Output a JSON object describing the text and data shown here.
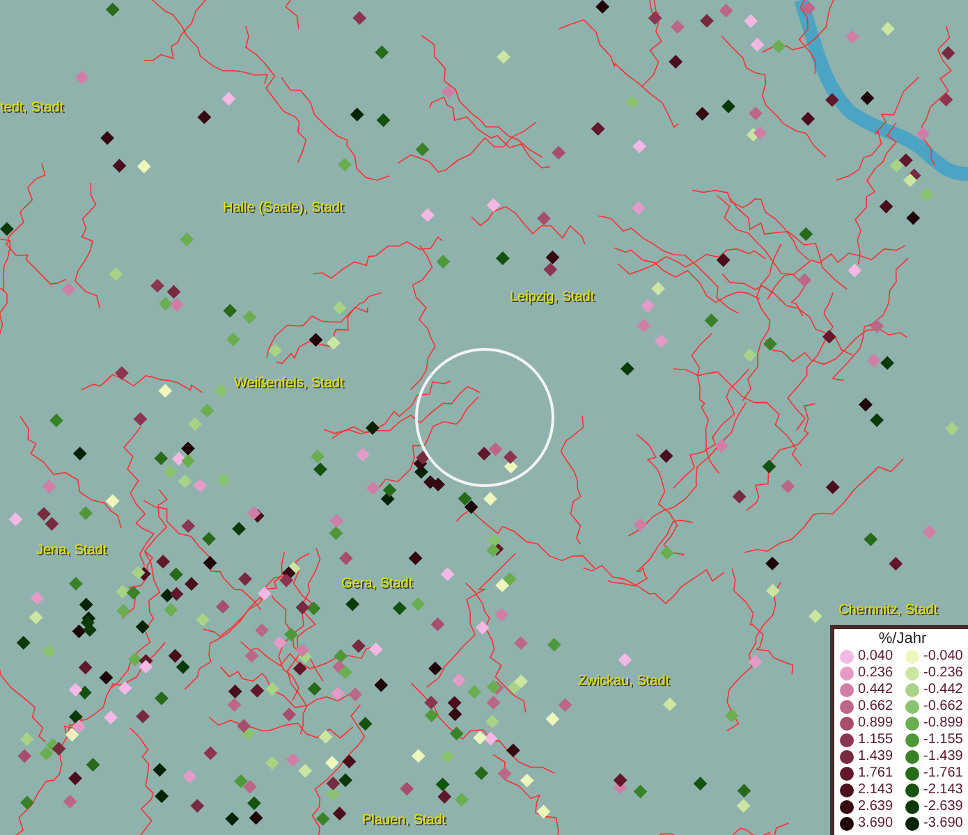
{
  "map": {
    "cities": [
      {
        "name": "tedt, Stadt"
      },
      {
        "name": "Halle (Saale), Stadt"
      },
      {
        "name": "Leipzig, Stadt"
      },
      {
        "name": "Weißenfels, Stadt"
      },
      {
        "name": "Jena, Stadt"
      },
      {
        "name": "Gera, Stadt"
      },
      {
        "name": "Chemnitz, Stadt"
      },
      {
        "name": "Zwickau, Stadt"
      },
      {
        "name": "Plauen, Stadt"
      }
    ]
  },
  "legend": {
    "title": "%/Jahr",
    "rows": [
      {
        "positive": {
          "label": "0.040",
          "color": "#f4b8e4"
        },
        "negative": {
          "label": "-0.040",
          "color": "#eef6bc"
        }
      },
      {
        "positive": {
          "label": "0.236",
          "color": "#e49cc6"
        },
        "negative": {
          "label": "-0.236",
          "color": "#cbe6a0"
        }
      },
      {
        "positive": {
          "label": "0.442",
          "color": "#d07ea6"
        },
        "negative": {
          "label": "-0.442",
          "color": "#a8d286"
        }
      },
      {
        "positive": {
          "label": "0.662",
          "color": "#bc6689"
        },
        "negative": {
          "label": "-0.662",
          "color": "#8ac36e"
        }
      },
      {
        "positive": {
          "label": "0.899",
          "color": "#a64e6c"
        },
        "negative": {
          "label": "-0.899",
          "color": "#6aae50"
        }
      },
      {
        "positive": {
          "label": "1.155",
          "color": "#8c3550"
        },
        "negative": {
          "label": "-1.155",
          "color": "#4e9838"
        }
      },
      {
        "positive": {
          "label": "1.439",
          "color": "#782a40"
        },
        "negative": {
          "label": "-1.439",
          "color": "#3a8228"
        }
      },
      {
        "positive": {
          "label": "1.761",
          "color": "#60182a"
        },
        "negative": {
          "label": "-1.761",
          "color": "#266a1a"
        }
      },
      {
        "positive": {
          "label": "2.143",
          "color": "#4a0e1c"
        },
        "negative": {
          "label": "-2.143",
          "color": "#145210"
        }
      },
      {
        "positive": {
          "label": "2.639",
          "color": "#360812"
        },
        "negative": {
          "label": "-2.639",
          "color": "#0a3a08"
        }
      },
      {
        "positive": {
          "label": "3.690",
          "color": "#1e0408"
        },
        "negative": {
          "label": "-3.690",
          "color": "#042204"
        }
      }
    ]
  }
}
